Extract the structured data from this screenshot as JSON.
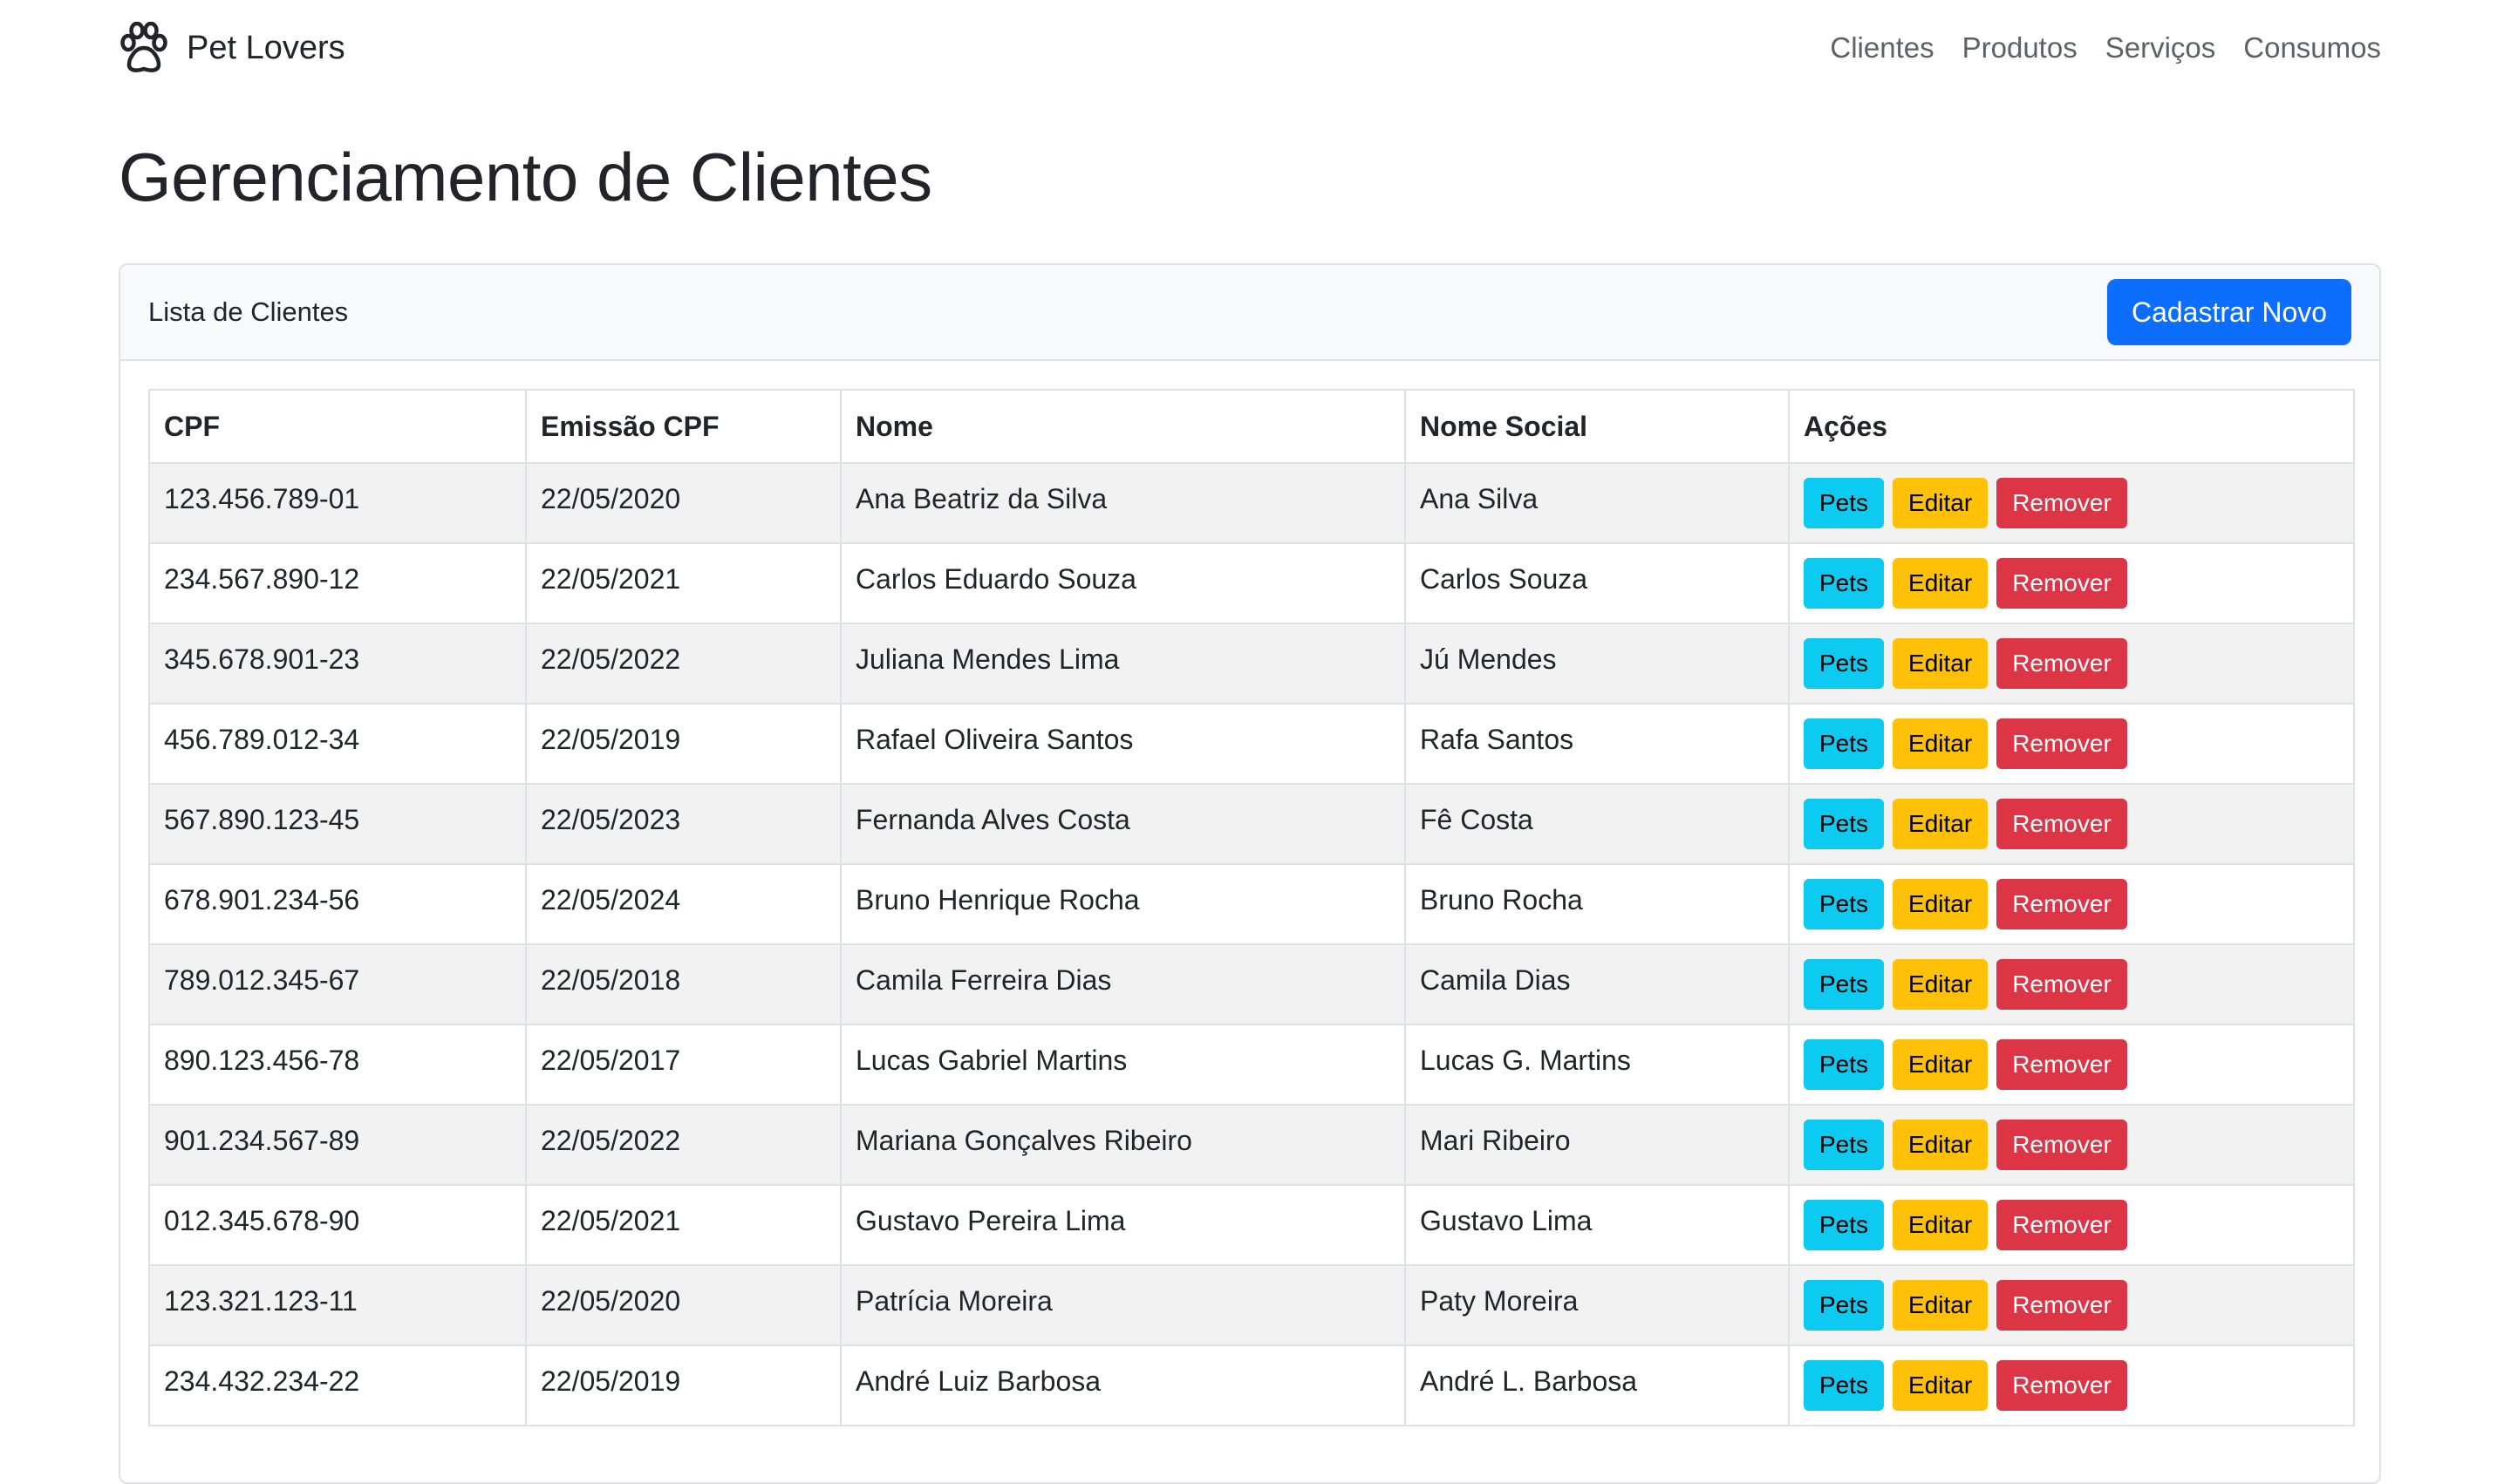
{
  "navbar": {
    "brand": "Pet Lovers",
    "brand_icon": "paw-icon",
    "links": [
      "Clientes",
      "Produtos",
      "Serviços",
      "Consumos"
    ]
  },
  "page": {
    "title": "Gerenciamento de Clientes"
  },
  "card": {
    "header_title": "Lista de Clientes",
    "new_button_label": "Cadastrar Novo"
  },
  "table": {
    "columns": [
      "CPF",
      "Emissão CPF",
      "Nome",
      "Nome Social",
      "Ações"
    ],
    "action_labels": {
      "pets": "Pets",
      "edit": "Editar",
      "remove": "Remover"
    },
    "rows": [
      {
        "cpf": "123.456.789-01",
        "emissao": "22/05/2020",
        "nome": "Ana Beatriz da Silva",
        "nome_social": "Ana Silva"
      },
      {
        "cpf": "234.567.890-12",
        "emissao": "22/05/2021",
        "nome": "Carlos Eduardo Souza",
        "nome_social": "Carlos Souza"
      },
      {
        "cpf": "345.678.901-23",
        "emissao": "22/05/2022",
        "nome": "Juliana Mendes Lima",
        "nome_social": "Jú Mendes"
      },
      {
        "cpf": "456.789.012-34",
        "emissao": "22/05/2019",
        "nome": "Rafael Oliveira Santos",
        "nome_social": "Rafa Santos"
      },
      {
        "cpf": "567.890.123-45",
        "emissao": "22/05/2023",
        "nome": "Fernanda Alves Costa",
        "nome_social": "Fê Costa"
      },
      {
        "cpf": "678.901.234-56",
        "emissao": "22/05/2024",
        "nome": "Bruno Henrique Rocha",
        "nome_social": "Bruno Rocha"
      },
      {
        "cpf": "789.012.345-67",
        "emissao": "22/05/2018",
        "nome": "Camila Ferreira Dias",
        "nome_social": "Camila Dias"
      },
      {
        "cpf": "890.123.456-78",
        "emissao": "22/05/2017",
        "nome": "Lucas Gabriel Martins",
        "nome_social": "Lucas G. Martins"
      },
      {
        "cpf": "901.234.567-89",
        "emissao": "22/05/2022",
        "nome": "Mariana Gonçalves Ribeiro",
        "nome_social": "Mari Ribeiro"
      },
      {
        "cpf": "012.345.678-90",
        "emissao": "22/05/2021",
        "nome": "Gustavo Pereira Lima",
        "nome_social": "Gustavo Lima"
      },
      {
        "cpf": "123.321.123-11",
        "emissao": "22/05/2020",
        "nome": "Patrícia Moreira",
        "nome_social": "Paty Moreira"
      },
      {
        "cpf": "234.432.234-22",
        "emissao": "22/05/2019",
        "nome": "André Luiz Barbosa",
        "nome_social": "André L. Barbosa"
      }
    ]
  },
  "colors": {
    "primary": "#0d6efd",
    "info": "#0dcaf0",
    "warning": "#ffc107",
    "danger": "#dc3545"
  }
}
